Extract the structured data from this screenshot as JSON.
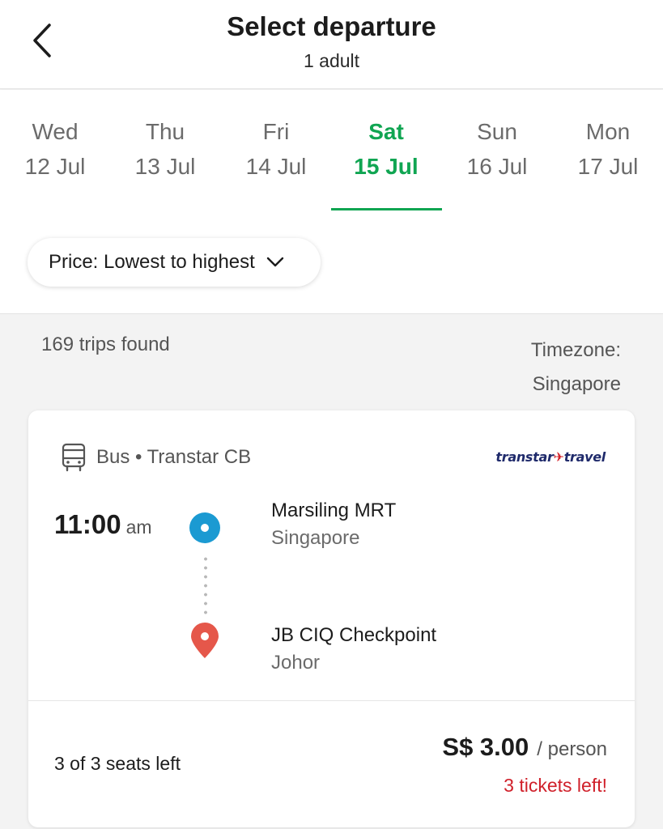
{
  "header": {
    "title": "Select departure",
    "subtitle": "1 adult",
    "back_icon": "chevron-left-icon"
  },
  "dates": [
    {
      "day": "Wed",
      "date": "12 Jul",
      "active": false
    },
    {
      "day": "Thu",
      "date": "13 Jul",
      "active": false
    },
    {
      "day": "Fri",
      "date": "14 Jul",
      "active": false
    },
    {
      "day": "Sat",
      "date": "15 Jul",
      "active": true
    },
    {
      "day": "Sun",
      "date": "16 Jul",
      "active": false
    },
    {
      "day": "Mon",
      "date": "17 Jul",
      "active": false
    }
  ],
  "sort": {
    "label": "Price: Lowest to highest",
    "icon": "chevron-down-icon"
  },
  "results": {
    "count_text": "169 trips found",
    "timezone_label": "Timezone:",
    "timezone_value": "Singapore"
  },
  "trip": {
    "mode_icon": "bus-icon",
    "operator_text": "Bus • Transtar CB",
    "brand_logo_text": "transtar travel",
    "time": "11:00",
    "ampm": "am",
    "origin": {
      "name": "Marsiling MRT",
      "region": "Singapore"
    },
    "destination": {
      "name": "JB CIQ Checkpoint",
      "region": "Johor"
    },
    "seats_left": "3 of 3 seats left",
    "price": "S$ 3.00",
    "per": "/ person",
    "tickets_left": "3 tickets left!"
  },
  "colors": {
    "accent_green": "#10a552",
    "origin_blue": "#1b9ad2",
    "destination_red": "#e5574a",
    "warning_red": "#d0202a"
  }
}
